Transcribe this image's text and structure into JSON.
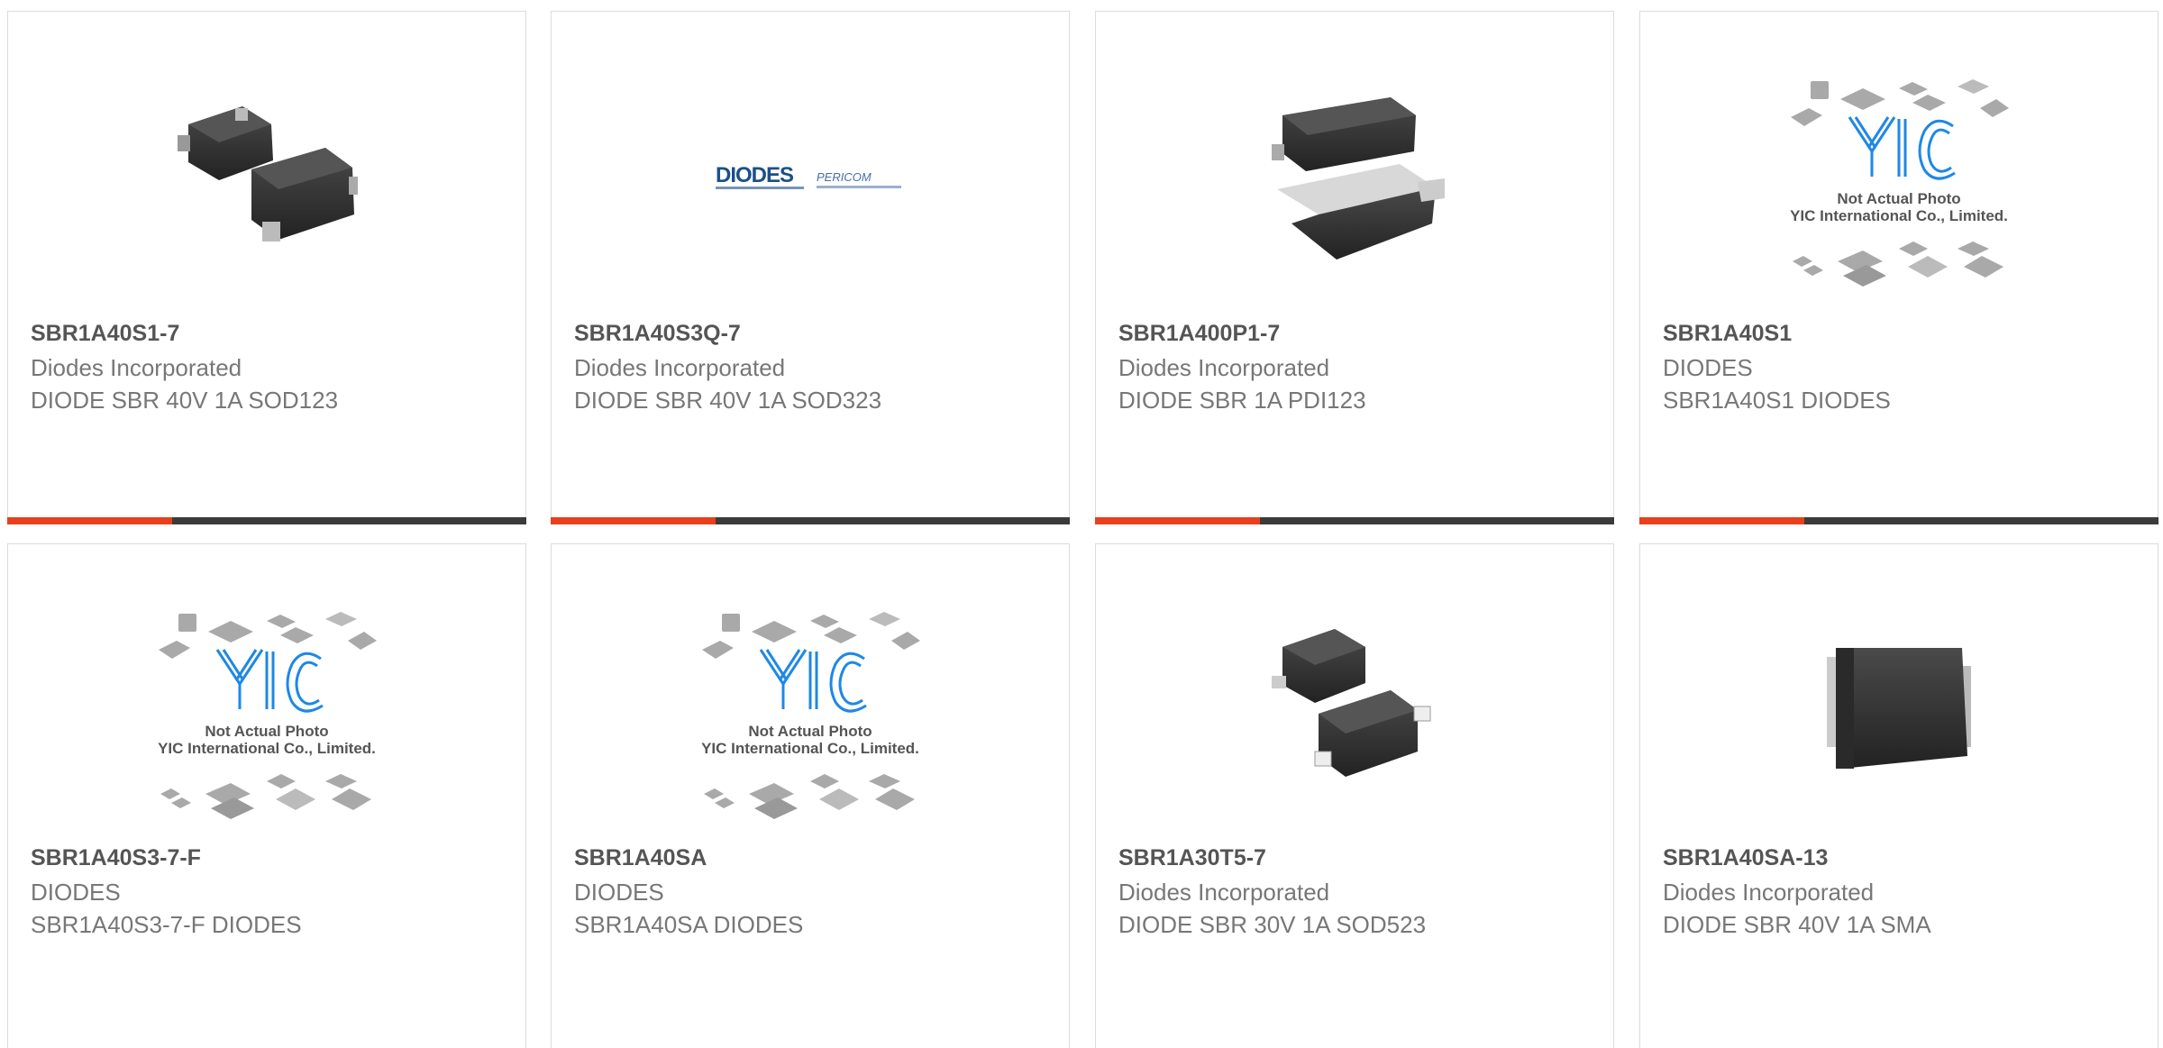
{
  "colors": {
    "accent": "#e8401c",
    "bar": "#3b3b3b",
    "border": "#dcdcdc",
    "title": "#555555",
    "text": "#777777",
    "yic_blue": "#1e88e5"
  },
  "placeholder": {
    "line1": "Not Actual Photo",
    "line2": "YIC International Co., Limited."
  },
  "logo": {
    "diodes": "DIODES",
    "pericom": "PERICOM"
  },
  "products": [
    {
      "part": "SBR1A40S1-7",
      "maker": "Diodes Incorporated",
      "desc": "DIODE SBR 40V 1A SOD123",
      "image": "sod123-photo-icon"
    },
    {
      "part": "SBR1A40S3Q-7",
      "maker": "Diodes Incorporated",
      "desc": "DIODE SBR 40V 1A SOD323",
      "image": "diodes-logo-icon"
    },
    {
      "part": "SBR1A400P1-7",
      "maker": "Diodes Incorporated",
      "desc": "DIODE SBR 1A PDI123",
      "image": "pdi123-photo-icon"
    },
    {
      "part": "SBR1A40S1",
      "maker": "DIODES",
      "desc": "SBR1A40S1 DIODES",
      "image": "yic-placeholder-icon"
    },
    {
      "part": "SBR1A40S3-7-F",
      "maker": "DIODES",
      "desc": "SBR1A40S3-7-F DIODES",
      "image": "yic-placeholder-icon"
    },
    {
      "part": "SBR1A40SA",
      "maker": "DIODES",
      "desc": "SBR1A40SA DIODES",
      "image": "yic-placeholder-icon"
    },
    {
      "part": "SBR1A30T5-7",
      "maker": "Diodes Incorporated",
      "desc": "DIODE SBR 30V 1A SOD523",
      "image": "sod523-photo-icon"
    },
    {
      "part": "SBR1A40SA-13",
      "maker": "Diodes Incorporated",
      "desc": "DIODE SBR 40V 1A SMA",
      "image": "sma-photo-icon"
    }
  ]
}
